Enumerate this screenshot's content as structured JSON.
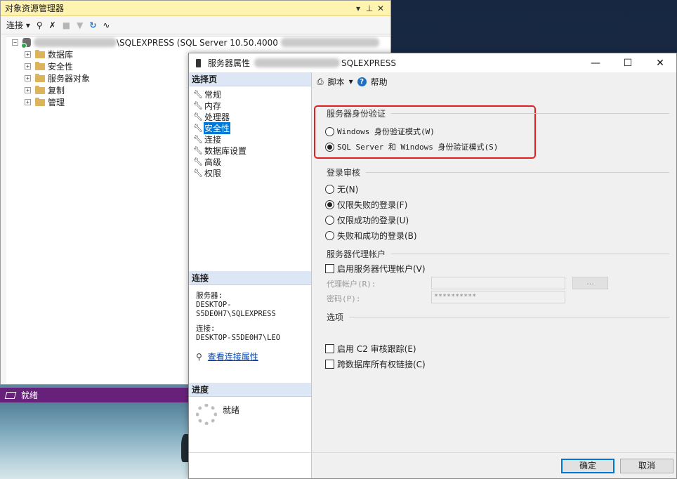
{
  "object_explorer": {
    "title": "对象资源管理器",
    "title_controls": {
      "pin": "▾",
      "dock": "⊥",
      "close": "✕"
    },
    "toolbar": {
      "connect_label": "连接",
      "connect_arrow": "▾"
    },
    "server_node": {
      "label": "\\SQLEXPRESS (SQL Server 10.50.4000"
    },
    "tree": [
      {
        "label": "数据库"
      },
      {
        "label": "安全性"
      },
      {
        "label": "服务器对象"
      },
      {
        "label": "复制"
      },
      {
        "label": "管理"
      }
    ],
    "expander_glyph": "+"
  },
  "status_bar": {
    "text": "就绪",
    "color": "#68217a"
  },
  "dialog": {
    "title_prefix": "服务器属性",
    "title_suffix": "SQLEXPRESS",
    "window_buttons": {
      "minimize": "—",
      "maximize": "☐",
      "close": "✕"
    },
    "left": {
      "select_page_header": "选择页",
      "pages": [
        {
          "label": "常规",
          "selected": false
        },
        {
          "label": "内存",
          "selected": false
        },
        {
          "label": "处理器",
          "selected": false
        },
        {
          "label": "安全性",
          "selected": true
        },
        {
          "label": "连接",
          "selected": false
        },
        {
          "label": "数据库设置",
          "selected": false
        },
        {
          "label": "高级",
          "selected": false
        },
        {
          "label": "权限",
          "selected": false
        }
      ],
      "connection_header": "连接",
      "server_label": "服务器:",
      "server_value": "DESKTOP-S5DE0H7\\SQLEXPRESS",
      "connection_label": "连接:",
      "connection_value": "DESKTOP-S5DE0H7\\LEO",
      "view_link": "查看连接属性",
      "progress_header": "进度",
      "progress_status": "就绪"
    },
    "right": {
      "toolbar": {
        "script_label": "脚本",
        "script_arrow": "▾",
        "help_label": "帮助"
      },
      "auth_group": "服务器身份验证",
      "auth_windows": "Windows 身份验证模式(W)",
      "auth_mixed": "SQL Server 和 Windows 身份验证模式(S)",
      "login_audit_group": "登录审核",
      "audit_none": "无(N)",
      "audit_failed": "仅限失败的登录(F)",
      "audit_success": "仅限成功的登录(U)",
      "audit_both": "失败和成功的登录(B)",
      "proxy_group": "服务器代理帐户",
      "proxy_enable": "启用服务器代理帐户(V)",
      "proxy_account_label": "代理帐户(R):",
      "password_label": "密码(P):",
      "password_value": "**********",
      "browse_button": "...",
      "options_group": "选项",
      "c2_audit": "启用 C2 审核跟踪(E)",
      "cross_db": "跨数据库所有权链接(C)"
    },
    "ok_button": "确定",
    "cancel_button": "取消",
    "highlight_color": "#e02020",
    "selection_color": "#0078d7"
  }
}
